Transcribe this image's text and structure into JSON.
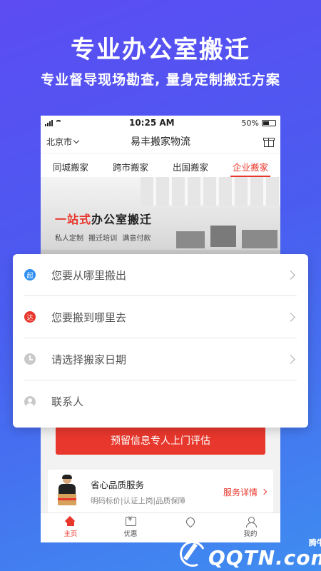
{
  "promo": {
    "title": "专业办公室搬迁",
    "subtitle": "专业督导现场勘查, 量身定制搬迁方案"
  },
  "statusbar": {
    "time": "10:25 AM",
    "battery": "50%"
  },
  "navbar": {
    "city": "北京市",
    "title": "易丰搬家物流",
    "gift_icon": "gift-icon"
  },
  "tabs": [
    {
      "label": "同城搬家",
      "active": false
    },
    {
      "label": "跨市搬家",
      "active": false
    },
    {
      "label": "出国搬家",
      "active": false
    },
    {
      "label": "企业搬家",
      "active": true
    }
  ],
  "banner": {
    "title_highlight": "一站式",
    "title_rest": "办公室搬迁",
    "subtitle": "私人定制  搬迁培训  满意付款"
  },
  "form": {
    "from": {
      "badge": "起",
      "placeholder": "您要从哪里搬出"
    },
    "to": {
      "badge": "达",
      "placeholder": "您要搬到哪里去"
    },
    "date": {
      "placeholder": "请选择搬家日期"
    },
    "contact": {
      "placeholder": "联系人"
    }
  },
  "submit_label": "预留信息专人上门评估",
  "service": {
    "title": "省心品质服务",
    "desc": "明码标价|认证上岗|品质保障",
    "link": "服务详情"
  },
  "bottom_nav": [
    {
      "label": "主页",
      "icon": "home-icon",
      "active": true
    },
    {
      "label": "优惠",
      "icon": "coupon-icon",
      "active": false
    },
    {
      "label": "",
      "icon": "location-icon",
      "active": false
    },
    {
      "label": "我的",
      "icon": "user-icon",
      "active": false
    }
  ],
  "watermark": {
    "small": "腾牛网",
    "big": "QQTN.com"
  },
  "colors": {
    "accent": "#e8372c",
    "background_gradient_start": "#5c4cf2",
    "background_gradient_end": "#3f8df0",
    "badge_blue": "#2f8ff0"
  }
}
